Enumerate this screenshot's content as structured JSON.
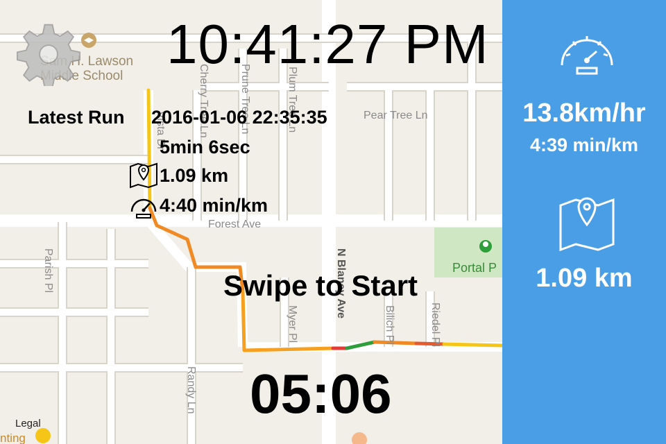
{
  "header": {
    "clock": "10:41:27 PM"
  },
  "map": {
    "streets": {
      "cherry": "Cherry Tree Ln",
      "prune": "Prune Tree Ln",
      "plum": "Plum Tree Ln",
      "pear": "Pear Tree Ln",
      "vista": "Vista Dr",
      "forest": "Forest Ave",
      "parish": "Parish Pl",
      "myer": "Myer Pl",
      "blaney": "N Blaney Ave",
      "bilich": "Bilich Pl",
      "riedel": "Riedel Pl",
      "randy": "Randy Ln"
    },
    "school": "Sam H. Lawson Middle School",
    "school_line1": "Sam H. Lawson",
    "school_line2": "Middle School",
    "park": "Portal P",
    "legal": "Legal",
    "bottom_fragment": "nting"
  },
  "latest_run": {
    "label": "Latest Run",
    "datetime": "2016-01-06 22:35:35",
    "duration": "5min 6sec",
    "distance": "1.09 km",
    "pace": "4:40 min/km",
    "icons": {
      "distance": "map-pin-icon",
      "pace": "speedometer-icon"
    }
  },
  "main": {
    "swipe_prompt": "Swipe to Start",
    "timer": "05:06"
  },
  "sidebar": {
    "speed": "13.8km/hr",
    "pace": "4:39 min/km",
    "distance": "1.09 km",
    "icons": {
      "speed": "speedometer-icon",
      "distance": "map-pin-icon"
    },
    "colors": {
      "background": "#4a9ee6",
      "text": "#ffffff"
    }
  },
  "route_colors": {
    "slow": "#f5c518",
    "medium": "#f08a24",
    "fast": "#e53935",
    "fastest": "#2e9e3a"
  }
}
